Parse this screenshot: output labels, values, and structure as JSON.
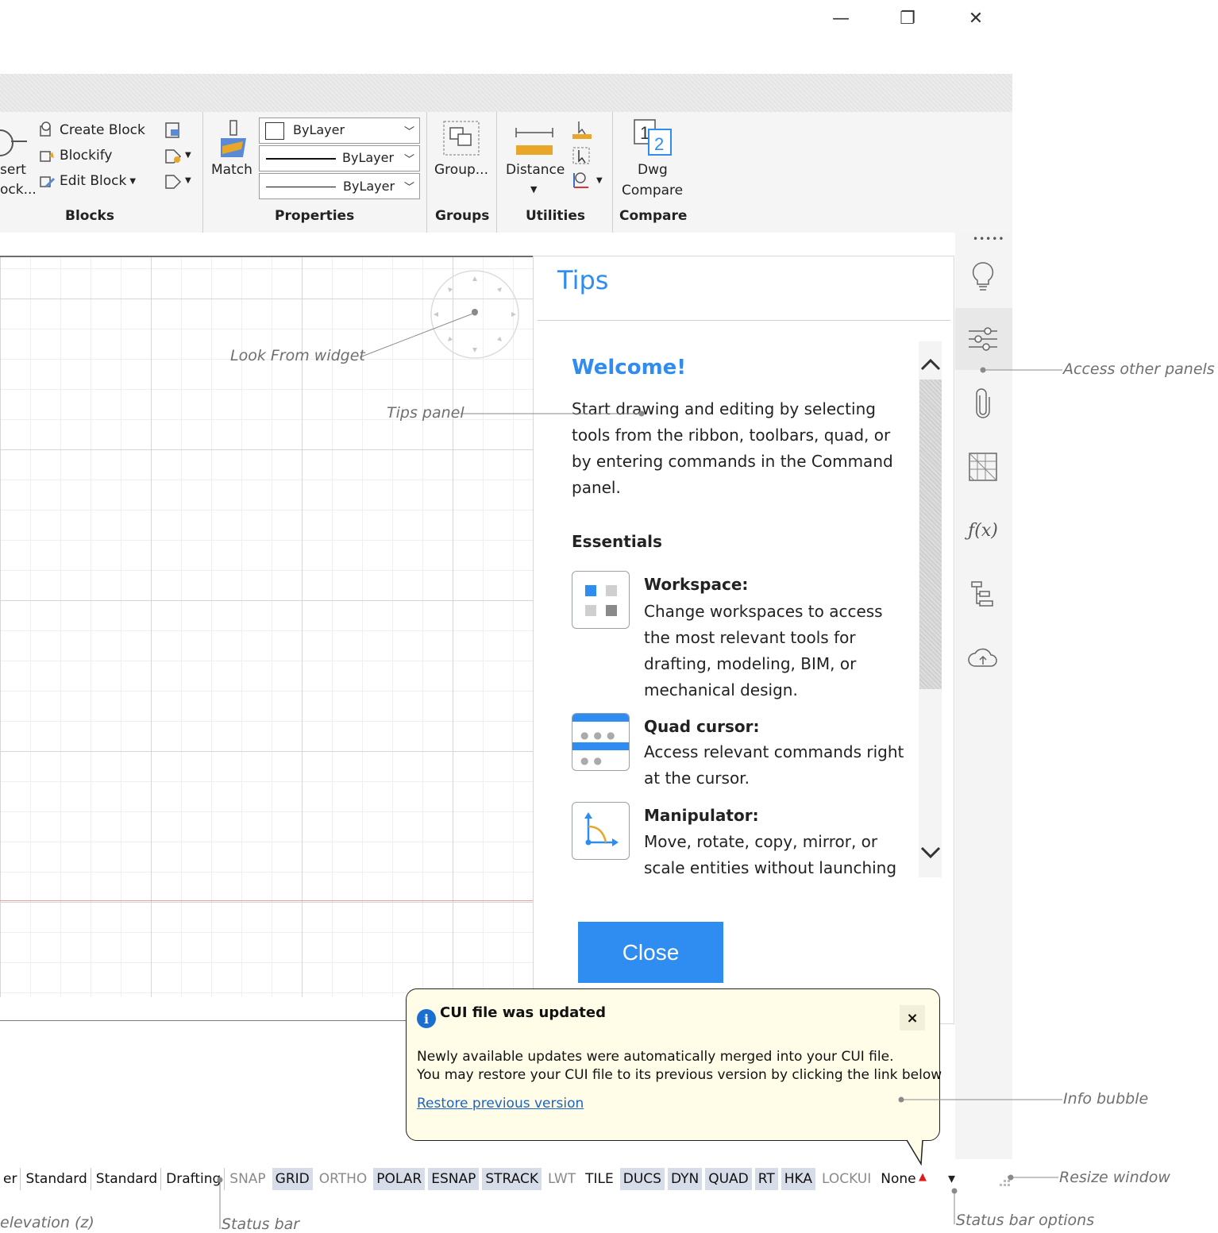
{
  "window": {
    "minimize_glyph": "—",
    "restore_glyph": "❐",
    "close_glyph": "✕"
  },
  "ribbon": {
    "blocks": {
      "insert_partial_1": "sert",
      "insert_partial_2": "ock...",
      "create_block": "Create Block",
      "blockify": "Blockify",
      "edit_block": "Edit Block",
      "group_label": "Blocks"
    },
    "properties": {
      "match": "Match",
      "color_value": "ByLayer",
      "linetype_value": "ByLayer",
      "lineweight_value": "ByLayer",
      "group_label": "Properties"
    },
    "groups": {
      "group_button": "Group...",
      "group_label": "Groups"
    },
    "utilities": {
      "distance": "Distance",
      "group_label": "Utilities"
    },
    "compare": {
      "dwg": "Dwg",
      "compare": "Compare",
      "group_label": "Compare",
      "icon_num_1": "1",
      "icon_num_2": "2"
    }
  },
  "tips": {
    "title": "Tips",
    "welcome": "Welcome!",
    "intro_lines": [
      "Start drawing and editing by selecting",
      "tools from the ribbon, toolbars, quad, or",
      "by entering commands in the Command",
      "panel."
    ],
    "essentials_title": "Essentials",
    "items": [
      {
        "title": "Workspace:",
        "lines": [
          "Change workspaces to access",
          "the most relevant tools for",
          "drafting, modeling, BIM, or",
          "mechanical design."
        ]
      },
      {
        "title": "Quad cursor:",
        "lines": [
          "Access relevant commands right",
          "at the cursor."
        ]
      },
      {
        "title": "Manipulator:",
        "lines": [
          "Move, rotate, copy, mirror, or",
          "scale entities without launching"
        ]
      }
    ],
    "close_button": "Close"
  },
  "bubble": {
    "title": "CUI file was updated",
    "line1": "Newly available updates were automatically merged into your CUI file.",
    "line2": "You may restore your CUI file to its previous version by clicking the link below",
    "link": "Restore previous version",
    "close_glyph": "×",
    "info_glyph": "i"
  },
  "statusbar": {
    "items": [
      {
        "label": "er",
        "state": "plain"
      },
      {
        "label": "Standard",
        "state": "plain"
      },
      {
        "label": "Standard",
        "state": "plain"
      },
      {
        "label": "Drafting",
        "state": "plain"
      },
      {
        "label": "SNAP",
        "state": "off"
      },
      {
        "label": "GRID",
        "state": "on"
      },
      {
        "label": "ORTHO",
        "state": "off"
      },
      {
        "label": "POLAR",
        "state": "on"
      },
      {
        "label": "ESNAP",
        "state": "on"
      },
      {
        "label": "STRACK",
        "state": "on"
      },
      {
        "label": "LWT",
        "state": "off"
      },
      {
        "label": "TILE",
        "state": "plain"
      },
      {
        "label": "DUCS",
        "state": "on"
      },
      {
        "label": "DYN",
        "state": "on"
      },
      {
        "label": "QUAD",
        "state": "on"
      },
      {
        "label": "RT",
        "state": "on"
      },
      {
        "label": "HKA",
        "state": "on"
      },
      {
        "label": "LOCKUI",
        "state": "off"
      },
      {
        "label": "None",
        "state": "plain"
      }
    ],
    "warning_glyph": "▲",
    "options_glyph": "▾"
  },
  "annotations": {
    "look_from": "Look From widget",
    "tips_panel": "Tips panel",
    "access_panels": "Access other panels",
    "info_bubble": "Info bubble",
    "resize_window": "Resize window",
    "status_bar": "Status bar",
    "status_bar_options": "Status bar options",
    "elevation": "elevation (z)"
  },
  "right_panel_icons": [
    "lightbulb-icon",
    "sliders-icon",
    "paperclip-icon",
    "hatch-icon",
    "function-icon",
    "tree-icon",
    "cloud-upload-icon"
  ],
  "colors": {
    "accent": "#2f8cf0",
    "bubble_bg": "#fffde7",
    "grid_line": "#d6d6d6",
    "axis_red": "#f19a9a"
  }
}
